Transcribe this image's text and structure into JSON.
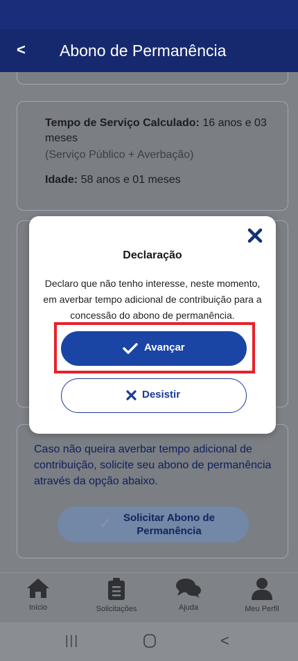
{
  "appbar": {
    "back_glyph": "<",
    "title": "Abono de Permanência"
  },
  "info_card": {
    "service_label": "Tempo de Serviço Calculado:",
    "service_value_line1": "16 anos e 03",
    "service_value_line2": "meses",
    "service_note": "(Serviço Público + Averbação)",
    "age_label": "Idade:",
    "age_value": "58 anos e 01 meses"
  },
  "bottom_card": {
    "text": "Caso não queira averbar tempo adicional de contribuição, solicite seu abono de permanência através da opção abaixo.",
    "button_line1": "Solicitar Abono de",
    "button_line2": "Permanência"
  },
  "modal": {
    "title": "Declaração",
    "body": "Declaro que não tenho interesse, neste momento, em averbar tempo adicional de contribuição para a concessão do abono de permanência.",
    "primary_label": "Avançar",
    "secondary_label": "Desistir",
    "highlight_color": "#e8202a",
    "primary_color": "#1a45a5"
  },
  "bottom_nav": {
    "items": [
      {
        "label": "Início",
        "icon": "home-icon"
      },
      {
        "label": "Solicitações",
        "icon": "clipboard-icon"
      },
      {
        "label": "Ajuda",
        "icon": "chat-icon"
      },
      {
        "label": "Meu Perfil",
        "icon": "user-icon"
      }
    ]
  },
  "system_nav": {
    "recents_glyph": "|||",
    "back_glyph": "<"
  }
}
